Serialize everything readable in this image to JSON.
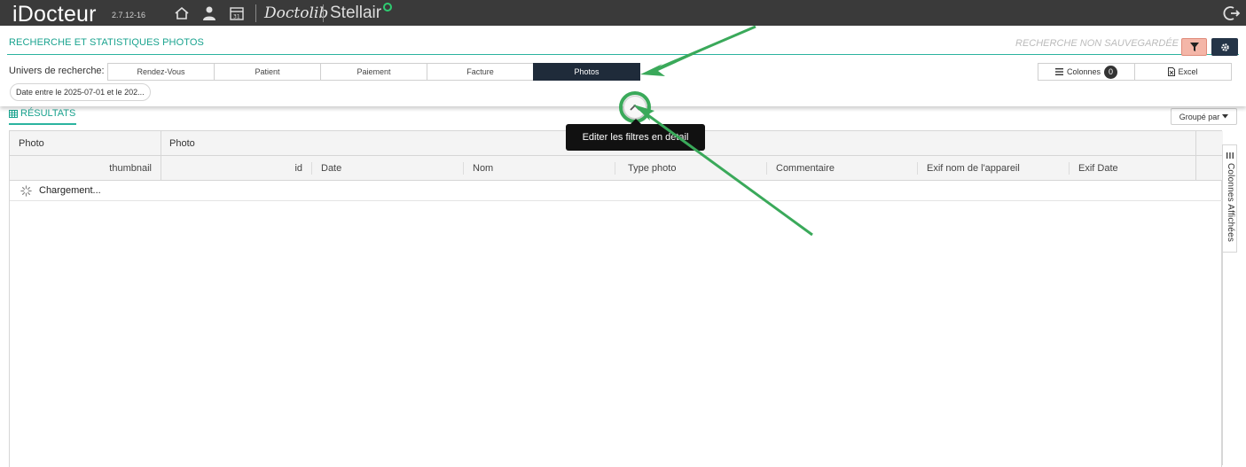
{
  "app": {
    "name": "iDocteur",
    "version": "2.7.12-16",
    "doctolib_label": "Doctolib",
    "stellair_label": "Stellair"
  },
  "filter_panel": {
    "title": "RECHERCHE ET STATISTIQUES PHOTOS",
    "unsaved_label": "RECHERCHE NON SAUVEGARDÉE",
    "univers_label": "Univers de recherche:",
    "tabs": [
      {
        "label": "Rendez-Vous",
        "active": false
      },
      {
        "label": "Patient",
        "active": false
      },
      {
        "label": "Paiement",
        "active": false
      },
      {
        "label": "Facture",
        "active": false
      },
      {
        "label": "Photos",
        "active": true
      }
    ],
    "columns_button": {
      "label": "Colonnes",
      "count": "0"
    },
    "excel_button": {
      "label": "Excel"
    },
    "date_chip": "Date entre le 2025-07-01 et le 202..."
  },
  "tooltip": "Editer les filtres en détail",
  "results": {
    "title": "RÉSULTATS",
    "group_by": "Groupé par",
    "group_headers": [
      "Photo",
      "Photo"
    ],
    "columns": [
      "thumbnail",
      "id",
      "Date",
      "Nom",
      "Type photo",
      "Commentaire",
      "Exif nom de l'appareil",
      "Exif Date"
    ],
    "loading": "Chargement...",
    "side_panel": "Colonnes Affichées"
  },
  "colors": {
    "accent": "#1aa38f",
    "topbar": "#3a3a3a",
    "active_tab": "#1f2b3a",
    "filter_button": "#f4b6a8",
    "annotation": "#3aa95a"
  }
}
